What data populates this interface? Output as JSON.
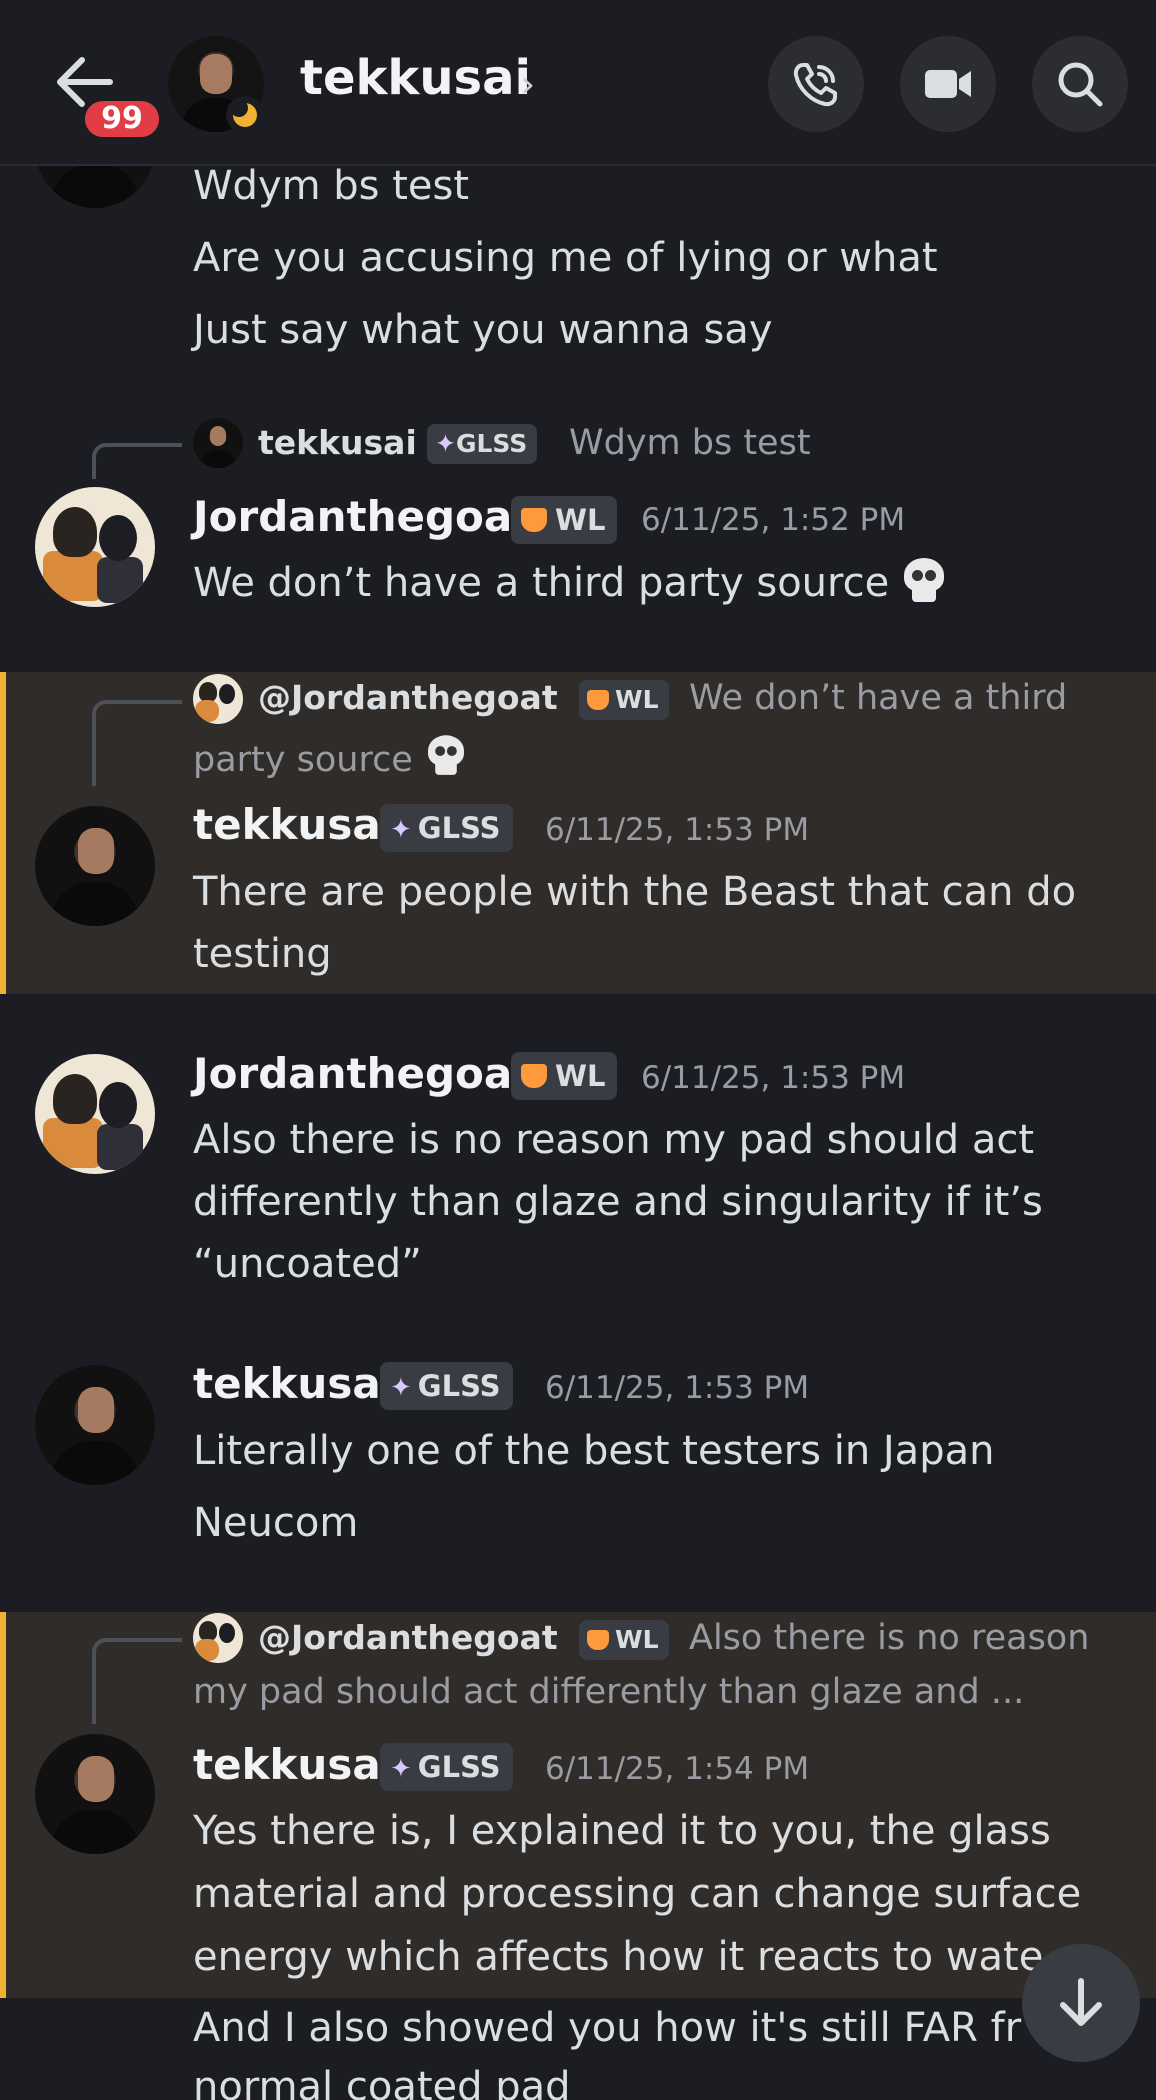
{
  "header": {
    "unread_count": "99",
    "title": "tekkusai",
    "chevron": "›"
  },
  "colors": {
    "background": "#1c1d23",
    "highlight": "#2f2c29",
    "mention_bar": "#f0b232",
    "badge": "#e23c45",
    "status_idle": "#f0b232"
  },
  "icons": [
    "back-arrow-icon",
    "phone-icon",
    "video-icon",
    "search-icon",
    "skull-icon",
    "scroll-down-icon",
    "glss-icon",
    "fox-icon"
  ],
  "messages": [
    {
      "lines": [
        "Wdym bs test",
        "Are you accusing me of lying or what",
        "Just say what you wanna say"
      ]
    },
    {
      "reply": {
        "author": "tekkusai",
        "tag": "GLSS",
        "text": "Wdym bs test"
      },
      "author": "Jordanthegoat",
      "tag": "WL",
      "timestamp": "6/11/25, 1:52 PM",
      "lines": [
        "We don’t have a third party source"
      ]
    },
    {
      "reply": {
        "author": "@Jordanthegoat",
        "tag": "WL",
        "text": "We don’t have a third",
        "text2": "party source"
      },
      "author": "tekkusai",
      "tag": "GLSS",
      "timestamp": "6/11/25, 1:53 PM",
      "lines": [
        "There are people with the Beast that can do",
        "testing"
      ]
    },
    {
      "author": "Jordanthegoat",
      "tag": "WL",
      "timestamp": "6/11/25, 1:53 PM",
      "lines": [
        "Also there is no reason my pad should act",
        "differently than glaze and singularity if it’s",
        "“uncoated”"
      ]
    },
    {
      "author": "tekkusai",
      "tag": "GLSS",
      "timestamp": "6/11/25, 1:53 PM",
      "lines": [
        "Literally one of the best testers in Japan",
        "Neucom"
      ]
    },
    {
      "reply": {
        "author": "@Jordanthegoat",
        "tag": "WL",
        "text": "Also there is no reason",
        "text2": "my pad should act differently than glaze and ..."
      },
      "author": "tekkusai",
      "tag": "GLSS",
      "timestamp": "6/11/25, 1:54 PM",
      "lines": [
        "Yes there is, I explained it to you, the glass",
        "material and processing can change surface",
        "energy which affects how it reacts to wate",
        "And I also showed you how it's still FAR fr",
        "normal coated pad"
      ]
    }
  ]
}
